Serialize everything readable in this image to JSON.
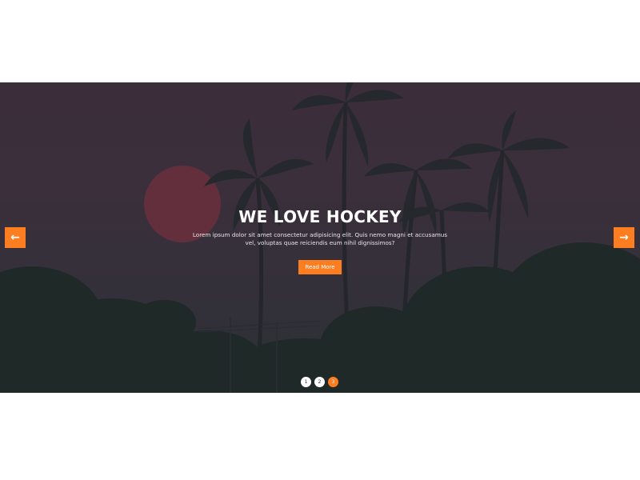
{
  "colors": {
    "accent": "#fd7e21",
    "overlay": "#3a2f3b"
  },
  "slider": {
    "title": "WE LOVE HOCKEY",
    "description": "Lorem ipsum dolor sit amet consectetur adipisicing elit. Quis nemo magni et accusamus vel, voluptas quae reiciendis eum nihil dignissimos?",
    "button_label": "Read More",
    "prev_icon": "arrow-left-icon",
    "next_icon": "arrow-right-icon",
    "prev_glyph": "←",
    "next_glyph": "→",
    "dots": [
      "1",
      "2",
      "3"
    ],
    "active_slide": 3
  }
}
